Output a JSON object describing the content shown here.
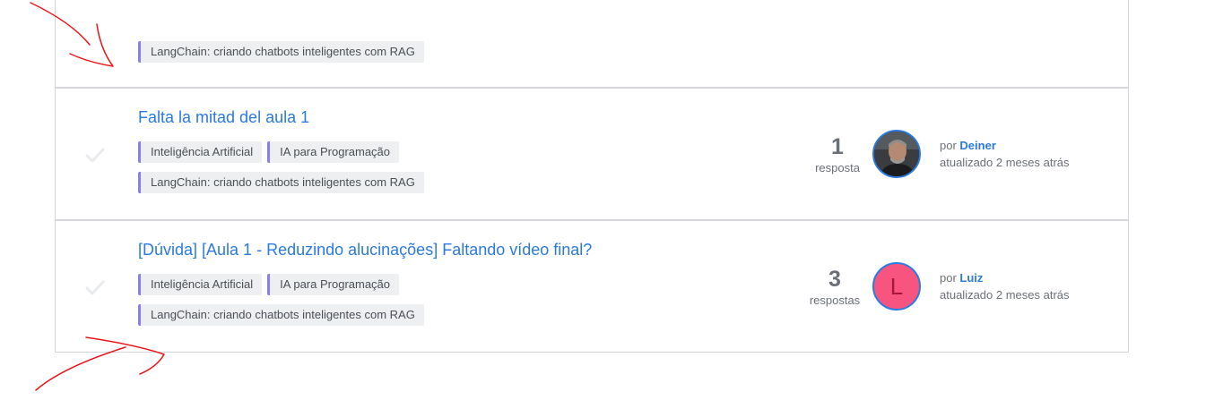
{
  "topics": [
    {
      "tags": [
        "LangChain: criando chatbots inteligentes com RAG"
      ]
    },
    {
      "title": "Falta la mitad del aula 1",
      "tags": [
        "Inteligência Artificial",
        "IA para Programação",
        "LangChain: criando chatbots inteligentes com RAG"
      ],
      "reply_count": "1",
      "reply_label": "resposta",
      "by_prefix": "por",
      "author": "Deiner",
      "updated": "atualizado 2 meses atrás",
      "avatar_icon": "user-photo"
    },
    {
      "title": "[Dúvida] [Aula 1 - Reduzindo alucinações] Faltando vídeo final?",
      "tags": [
        "Inteligência Artificial",
        "IA para Programação",
        "LangChain: criando chatbots inteligentes com RAG"
      ],
      "reply_count": "3",
      "reply_label": "respostas",
      "by_prefix": "por",
      "author": "Luiz",
      "updated": "atualizado 2 meses atrás",
      "avatar_letter": "L",
      "avatar_color": "#f7557f"
    }
  ],
  "colors": {
    "link": "#2a7ae2",
    "tag_accent": "#8b7ff0",
    "annotation": "#e8161b"
  }
}
